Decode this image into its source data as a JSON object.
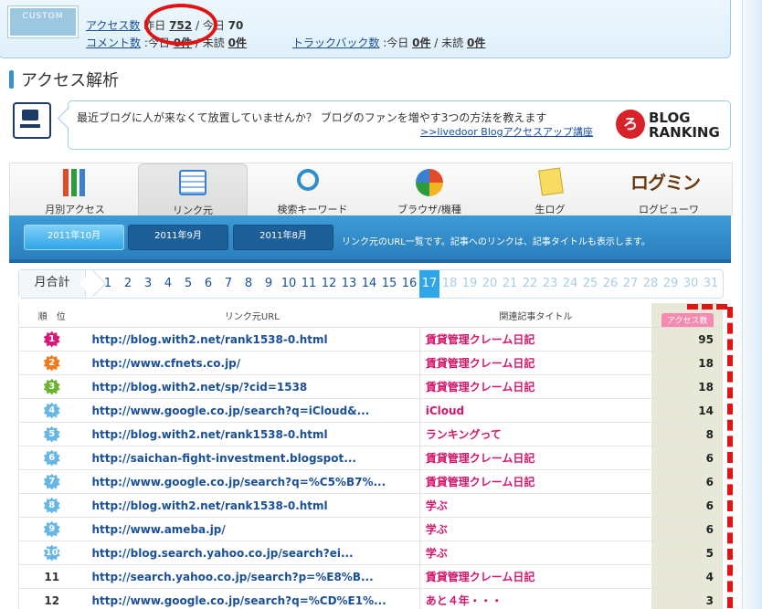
{
  "summary": {
    "logo_text": "CUSTOM",
    "access_label": "アクセス数",
    "yesterday_label": "昨日",
    "yesterday_value": "752",
    "today_label": "今日",
    "today_value": "70",
    "comment_label": "コメント数",
    "comment_today": "今日",
    "comment_today_value": "0件",
    "comment_unread": "/ 未読",
    "comment_unread_value": "0件",
    "trackback_label": "トラックバック数",
    "tb_today": "今日",
    "tb_today_value": "0件",
    "tb_unread": "/ 未読",
    "tb_unread_value": "0件"
  },
  "section_title": "アクセス解析",
  "promo": {
    "text": "最近ブログに人が来なくて放置していませんか？ ブログのファンを増やす3つの方法を教えます",
    "link": ">>livedoor Blogアクセスアップ講座",
    "brand_line1": "BLOG",
    "brand_line2": "RANKING"
  },
  "tabs": [
    {
      "label": "月別アクセス",
      "icon": "bar-chart-icon"
    },
    {
      "label": "リンク元",
      "icon": "link-list-icon"
    },
    {
      "label": "検索キーワード",
      "icon": "magnifier-icon"
    },
    {
      "label": "ブラウザ/機種",
      "icon": "pie-chart-icon"
    },
    {
      "label": "生ログ",
      "icon": "note-icon"
    },
    {
      "label": "ログビューワ",
      "icon": "logo-icon",
      "logo_text": "ログミン"
    }
  ],
  "months": [
    "2011年10月",
    "2011年9月",
    "2011年8月"
  ],
  "month_desc": "リンク元のURL一覧です。記事へのリンクは、記事タイトルも表示します。",
  "day_selector": {
    "label": "月合計",
    "days": [
      "1",
      "2",
      "3",
      "4",
      "5",
      "6",
      "7",
      "8",
      "9",
      "10",
      "11",
      "12",
      "13",
      "14",
      "15",
      "16",
      "17",
      "18",
      "19",
      "20",
      "21",
      "22",
      "23",
      "24",
      "25",
      "26",
      "27",
      "28",
      "29",
      "30",
      "31"
    ],
    "current": "17"
  },
  "table": {
    "headers": {
      "rank": "順　位",
      "url": "リンク元URL",
      "title": "関連記事タイトル",
      "count": "アクセス数"
    },
    "rows": [
      {
        "rank": "1",
        "url": "http://blog.with2.net/rank1538-0.html",
        "title": "賃貸管理クレーム日記",
        "count": "95",
        "color": "#d81b7a"
      },
      {
        "rank": "2",
        "url": "http://www.cfnets.co.jp/",
        "title": "賃貸管理クレーム日記",
        "count": "18",
        "color": "#f07b1f"
      },
      {
        "rank": "3",
        "url": "http://blog.with2.net/sp/?cid=1538",
        "title": "賃貸管理クレーム日記",
        "count": "18",
        "color": "#6ab42e"
      },
      {
        "rank": "4",
        "url": "http://www.google.co.jp/search?q=iCloud&...",
        "title": "iCloud",
        "count": "14",
        "color": "#66b6e6"
      },
      {
        "rank": "5",
        "url": "http://blog.with2.net/rank1538-0.html",
        "title": "ランキングって",
        "count": "8",
        "color": "#66b6e6"
      },
      {
        "rank": "6",
        "url": "http://saichan-fight-investment.blogspot...",
        "title": "賃貸管理クレーム日記",
        "count": "6",
        "color": "#66b6e6"
      },
      {
        "rank": "7",
        "url": "http://www.google.co.jp/search?q=%C5%B7%...",
        "title": "賃貸管理クレーム日記",
        "count": "6",
        "color": "#66b6e6"
      },
      {
        "rank": "8",
        "url": "http://blog.with2.net/rank1538-0.html",
        "title": "学ぶ",
        "count": "6",
        "color": "#66b6e6"
      },
      {
        "rank": "9",
        "url": "http://www.ameba.jp/",
        "title": "学ぶ",
        "count": "6",
        "color": "#66b6e6"
      },
      {
        "rank": "10",
        "url": "http://blog.search.yahoo.co.jp/search?ei...",
        "title": "学ぶ",
        "count": "5",
        "color": "#66b6e6"
      },
      {
        "rank": "11",
        "url": "http://search.yahoo.co.jp/search?p=%E8%B...",
        "title": "賃貸管理クレーム日記",
        "count": "4",
        "color": ""
      },
      {
        "rank": "12",
        "url": "http://www.google.co.jp/search?q=%CD%E1%...",
        "title": "あと４年・・・",
        "count": "3",
        "color": ""
      }
    ]
  }
}
